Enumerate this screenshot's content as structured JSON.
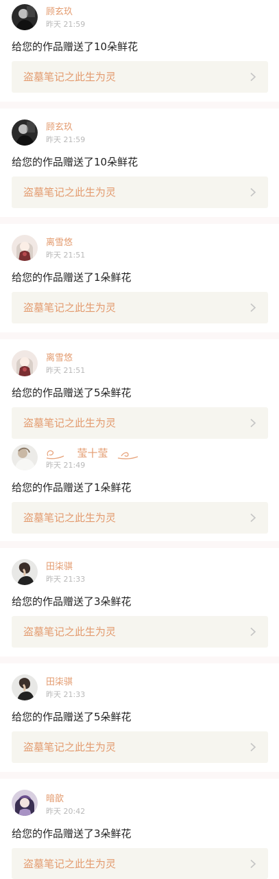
{
  "notifications": [
    {
      "user": "顾玄玖",
      "time": "昨天 21:59",
      "message": "给您的作品赠送了10朵鲜花",
      "work": "盗墓笔记之此生为灵",
      "avatar_icon": "dark-portrait-avatar"
    },
    {
      "user": "顾玄玖",
      "time": "昨天 21:59",
      "message": "给您的作品赠送了10朵鲜花",
      "work": "盗墓笔记之此生为灵",
      "avatar_icon": "dark-portrait-avatar"
    },
    {
      "user": "离雪悠",
      "time": "昨天 21:51",
      "message": "给您的作品赠送了1朵鲜花",
      "work": "盗墓笔记之此生为灵",
      "avatar_icon": "anime-girl-avatar"
    },
    {
      "user": "离雪悠",
      "time": "昨天 21:51",
      "message": "给您的作品赠送了5朵鲜花",
      "work": "盗墓笔记之此生为灵",
      "avatar_icon": "anime-girl-avatar"
    },
    {
      "user": "莹十莹",
      "time": "昨天 21:49",
      "message": "给您的作品赠送了1朵鲜花",
      "work": "盗墓笔记之此生为灵",
      "avatar_icon": "light-photo-avatar"
    },
    {
      "user": "田柒骐",
      "time": "昨天 21:33",
      "message": "给您的作品赠送了3朵鲜花",
      "work": "盗墓笔记之此生为灵",
      "avatar_icon": "profile-portrait-avatar"
    },
    {
      "user": "田柒骐",
      "time": "昨天 21:33",
      "message": "给您的作品赠送了5朵鲜花",
      "work": "盗墓笔记之此生为灵",
      "avatar_icon": "profile-portrait-avatar"
    },
    {
      "user": "暗歆",
      "time": "昨天 20:42",
      "message": "给您的作品赠送了3朵鲜花",
      "work": "盗墓笔记之此生为灵",
      "avatar_icon": "purple-hair-avatar"
    }
  ],
  "colors": {
    "username": "#e39b6f",
    "work_title": "#e39b6f",
    "timestamp": "#b8b8b8",
    "message": "#222222",
    "link_background": "#f6f5ef",
    "separator": "#fcf7f7"
  }
}
